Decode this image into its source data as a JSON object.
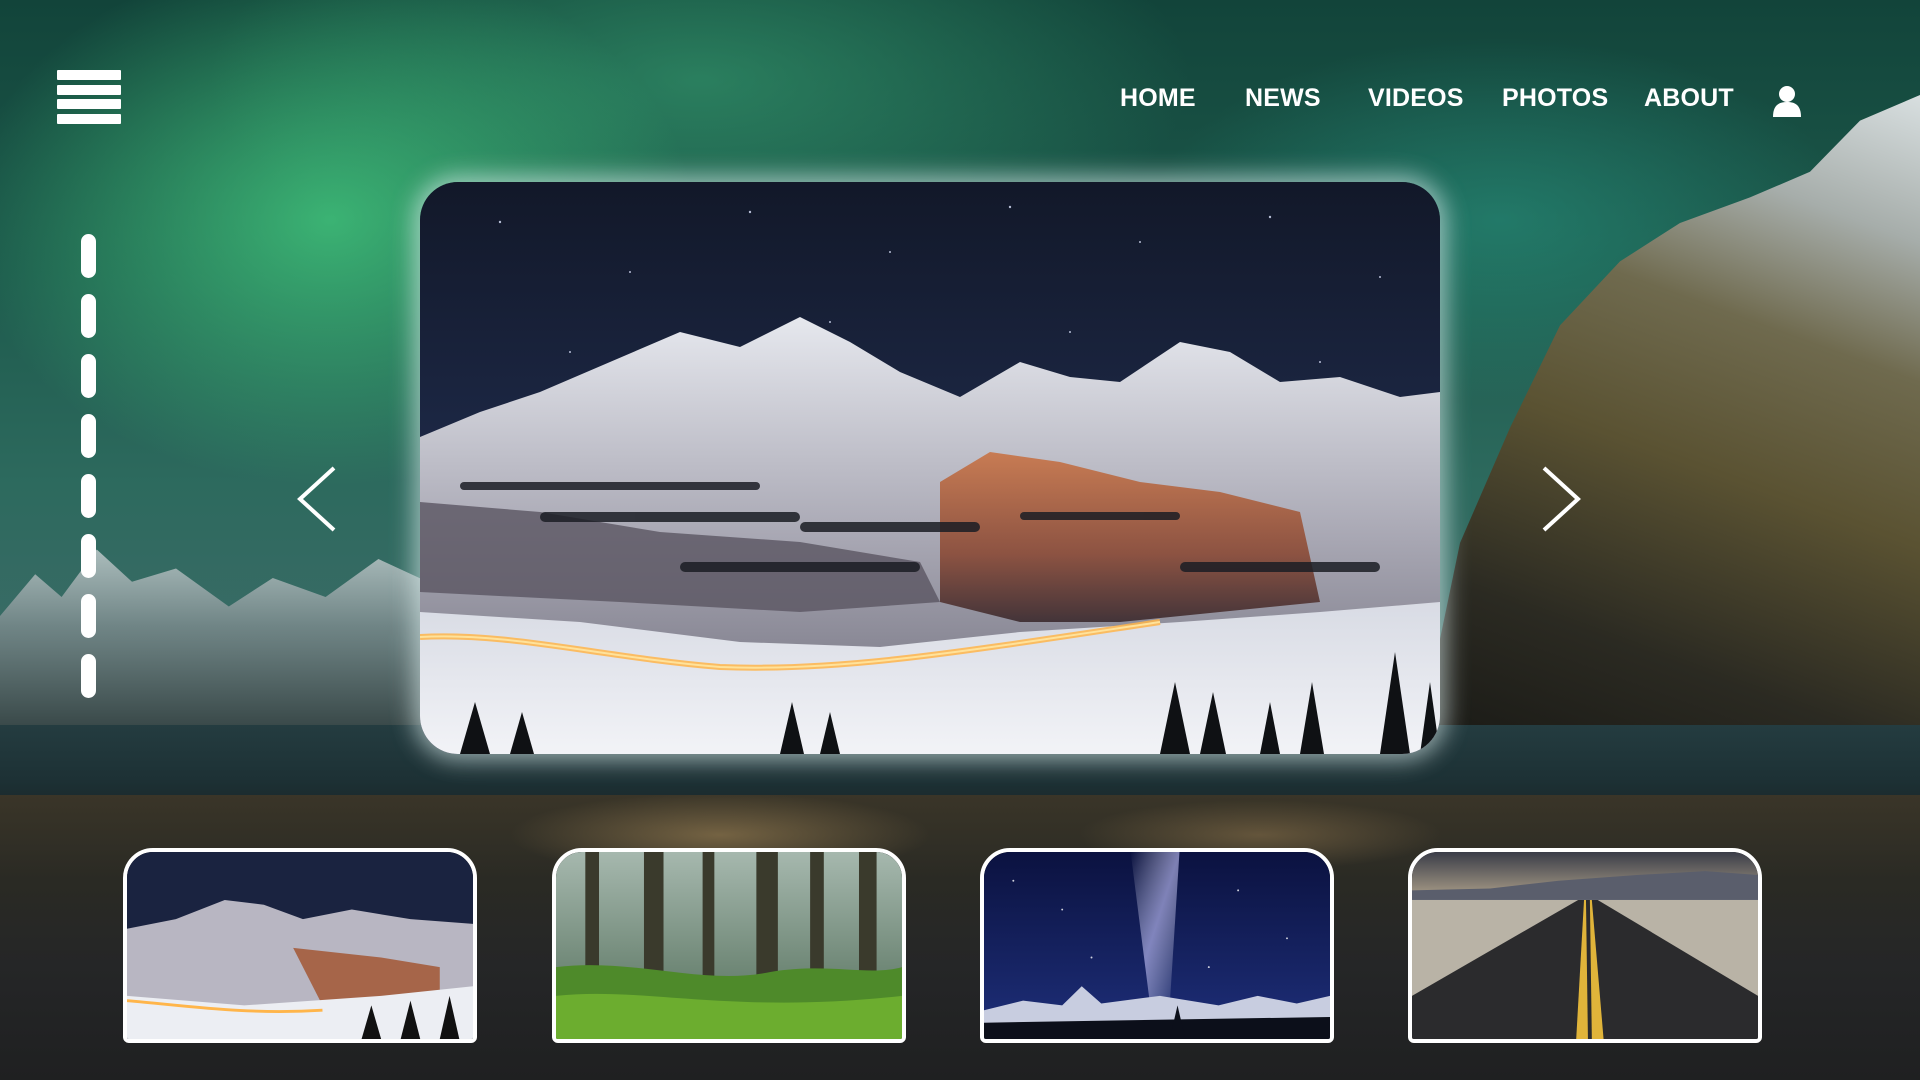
{
  "nav": {
    "items": [
      {
        "label": "HOME"
      },
      {
        "label": "NEWS"
      },
      {
        "label": "VIDEOS"
      },
      {
        "label": "PHOTOS"
      },
      {
        "label": "ABOUT"
      }
    ]
  },
  "icons": {
    "menu": "hamburger-menu-icon",
    "user": "user-icon",
    "prev": "chevron-left-icon",
    "next": "chevron-right-icon"
  },
  "slider": {
    "indicator_count": 8,
    "active_slide": 1,
    "main_image": "snowy-mountain-night",
    "thumbnails": [
      {
        "subject": "snowy-mountain-night"
      },
      {
        "subject": "mossy-forest"
      },
      {
        "subject": "milky-way-mountains"
      },
      {
        "subject": "desert-road"
      }
    ]
  },
  "colors": {
    "text": "#ffffff",
    "frame": "#ffffff"
  }
}
